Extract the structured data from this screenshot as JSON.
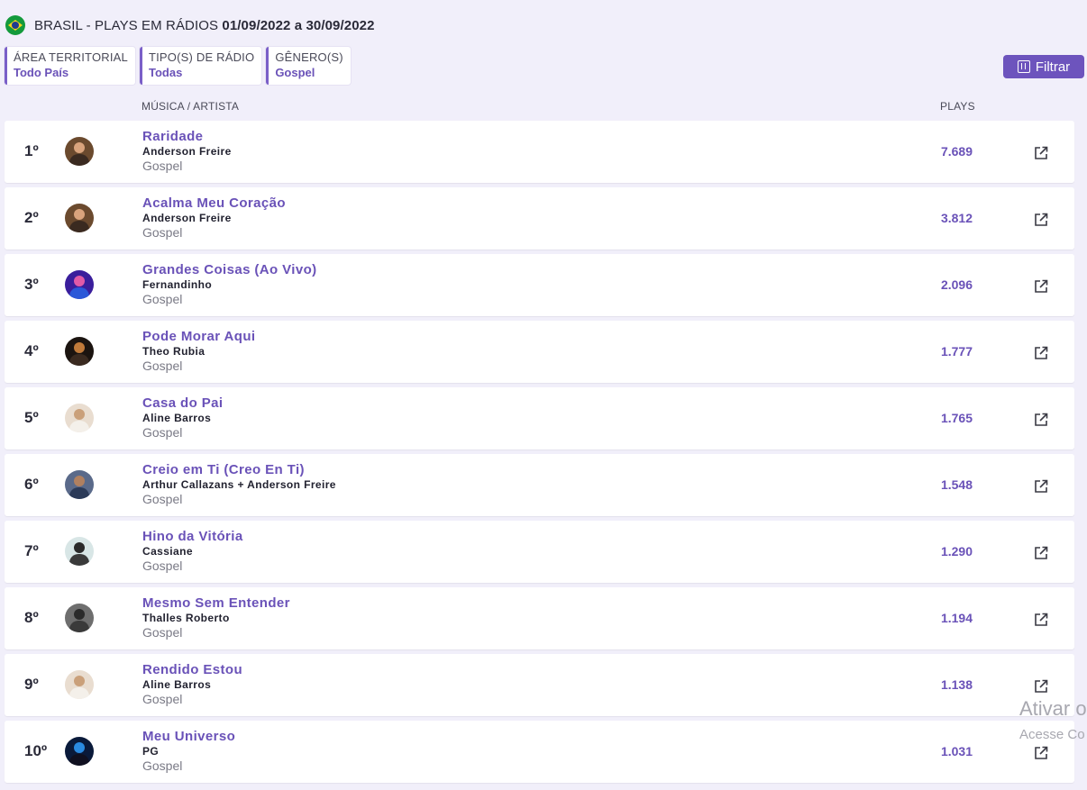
{
  "header": {
    "flag_icon": "brazil-flag-icon",
    "title_prefix": "BRASIL - PLAYS EM RÁDIOS",
    "date_range": "01/09/2022 a 30/09/2022"
  },
  "filters": [
    {
      "label": "ÁREA TERRITORIAL",
      "value": "Todo País"
    },
    {
      "label": "TIPO(S) DE RÁDIO",
      "value": "Todas"
    },
    {
      "label": "GÊNERO(S)",
      "value": "Gospel"
    }
  ],
  "filter_button": {
    "label": "Filtrar",
    "icon": "filter-sliders-icon"
  },
  "columns": {
    "music_artist": "MÚSICA / ARTISTA",
    "plays": "PLAYS"
  },
  "rows": [
    {
      "rank": "1º",
      "song": "Raridade",
      "artist": "Anderson Freire",
      "genre": "Gospel",
      "plays": "7.689"
    },
    {
      "rank": "2º",
      "song": "Acalma Meu Coração",
      "artist": "Anderson Freire",
      "genre": "Gospel",
      "plays": "3.812"
    },
    {
      "rank": "3º",
      "song": "Grandes Coisas (Ao Vivo)",
      "artist": "Fernandinho",
      "genre": "Gospel",
      "plays": "2.096"
    },
    {
      "rank": "4º",
      "song": "Pode Morar Aqui",
      "artist": "Theo Rubia",
      "genre": "Gospel",
      "plays": "1.777"
    },
    {
      "rank": "5º",
      "song": "Casa do Pai",
      "artist": "Aline Barros",
      "genre": "Gospel",
      "plays": "1.765"
    },
    {
      "rank": "6º",
      "song": "Creio em Ti (Creo En Ti)",
      "artist": "Arthur Callazans + Anderson Freire",
      "genre": "Gospel",
      "plays": "1.548"
    },
    {
      "rank": "7º",
      "song": "Hino da Vitória",
      "artist": "Cassiane",
      "genre": "Gospel",
      "plays": "1.290"
    },
    {
      "rank": "8º",
      "song": "Mesmo Sem Entender",
      "artist": "Thalles Roberto",
      "genre": "Gospel",
      "plays": "1.194"
    },
    {
      "rank": "9º",
      "song": "Rendido Estou",
      "artist": "Aline Barros",
      "genre": "Gospel",
      "plays": "1.138"
    },
    {
      "rank": "10º",
      "song": "Meu Universo",
      "artist": "PG",
      "genre": "Gospel",
      "plays": "1.031"
    }
  ],
  "colors": {
    "accent": "#6a52b8",
    "background": "#f1effa"
  },
  "watermark": {
    "line1": "Ativar o",
    "line2": "Acesse Co"
  }
}
